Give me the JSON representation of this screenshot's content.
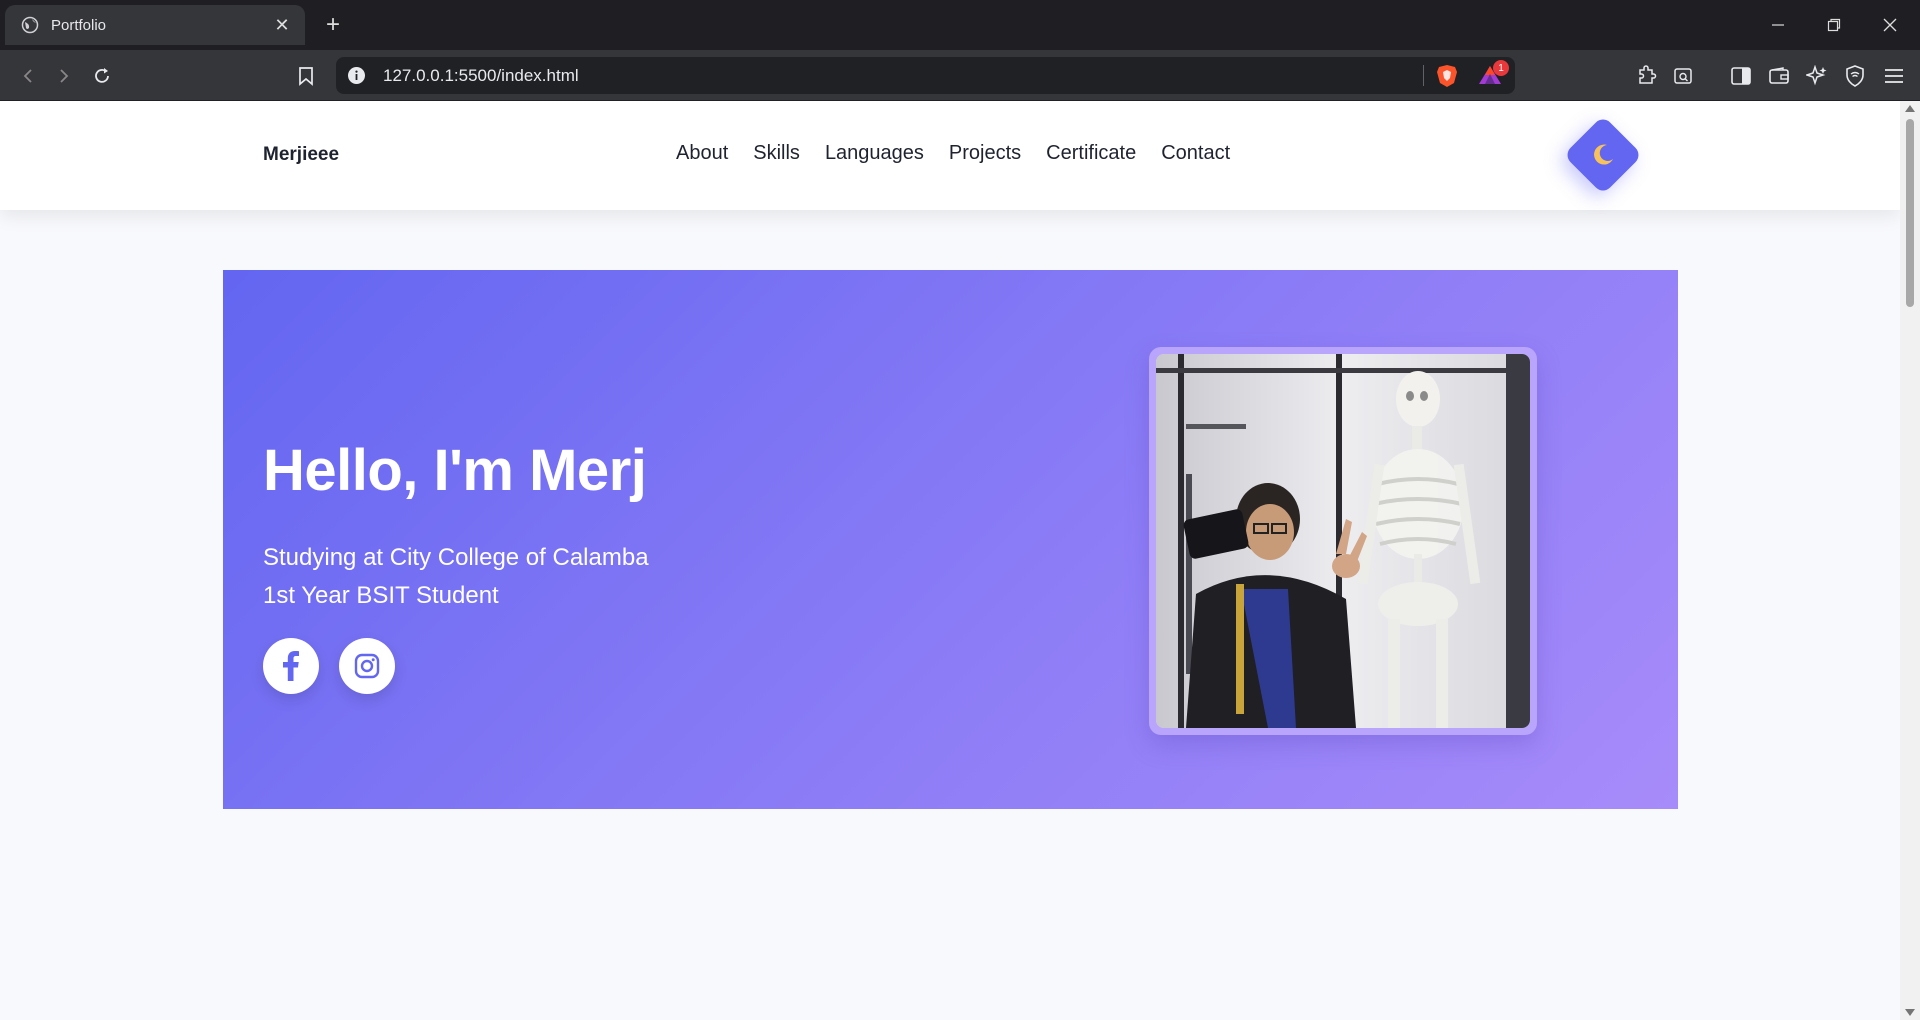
{
  "browser": {
    "tab_title": "Portfolio",
    "url": "127.0.0.1:5500/index.html",
    "notification_count": "1"
  },
  "nav": {
    "brand": "Merjieee",
    "links": [
      "About",
      "Skills",
      "Languages",
      "Projects",
      "Certificate",
      "Contact"
    ],
    "theme_toggle_icon": "moon-icon"
  },
  "hero": {
    "heading": "Hello, I'm Merj",
    "line1": "Studying at City College of Calamba",
    "line2": "1st Year BSIT Student",
    "social": [
      "facebook-icon",
      "instagram-icon"
    ],
    "photo": "profile-photo"
  },
  "colors": {
    "accent": "#6366f1",
    "gradient_end": "#a78bfa",
    "text_dark": "#1f2330"
  }
}
